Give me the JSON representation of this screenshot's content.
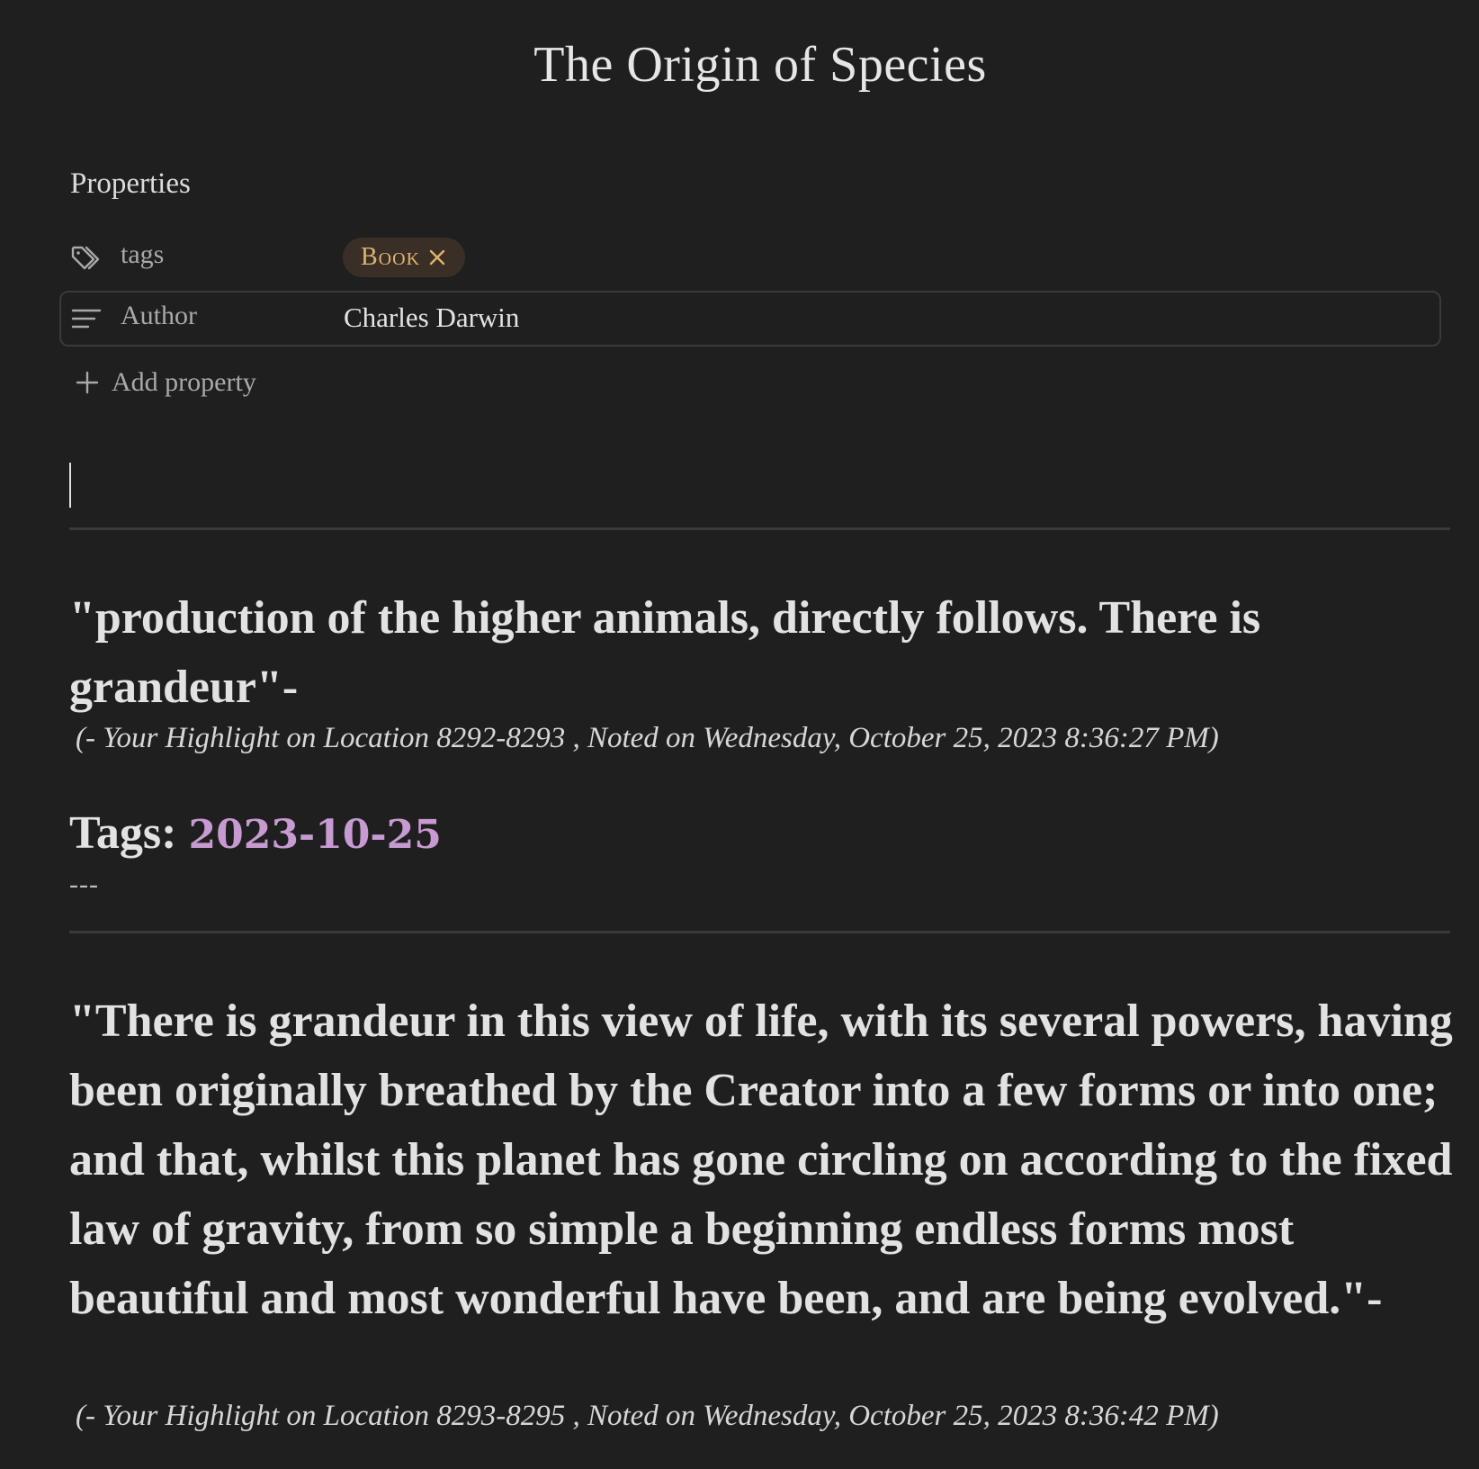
{
  "document": {
    "title": "The Origin of Species"
  },
  "properties": {
    "heading": "Properties",
    "tags": {
      "key": "tags",
      "icon": "tag-icon",
      "values": [
        {
          "label": "Book",
          "remove_icon": "close-icon"
        }
      ],
      "tag_color": "#e0b36d"
    },
    "author": {
      "key": "Author",
      "icon": "text-lines-icon",
      "value": "Charles Darwin"
    },
    "add_label": "Add property",
    "add_icon": "plus-icon"
  },
  "highlights": [
    {
      "quote": "\"production of the higher animals, directly follows. There is grandeur\"-",
      "note": "(- Your Highlight on Location 8292-8293 , Noted on Wednesday, October 25, 2023 8:36:27 PM)"
    },
    {
      "quote": "\"There is grandeur in this view of life, with its several powers, having been originally breathed by the Creator into a few forms or into one; and that, whilst this planet has gone circling on according to the fixed law of gravity, from so simple a beginning endless forms most beautiful and most wonderful have been, and are being evolved.\"-",
      "note": "(- Your Highlight on Location 8293-8295 , Noted on Wednesday, October 25, 2023 8:36:42 PM)"
    }
  ],
  "tags_section": {
    "label": "Tags:",
    "link": "2023-10-25",
    "link_color": "#c79ad1",
    "separator": "---"
  },
  "theme": {
    "background": "#1f1f1f",
    "text": "#e2e2e2"
  }
}
